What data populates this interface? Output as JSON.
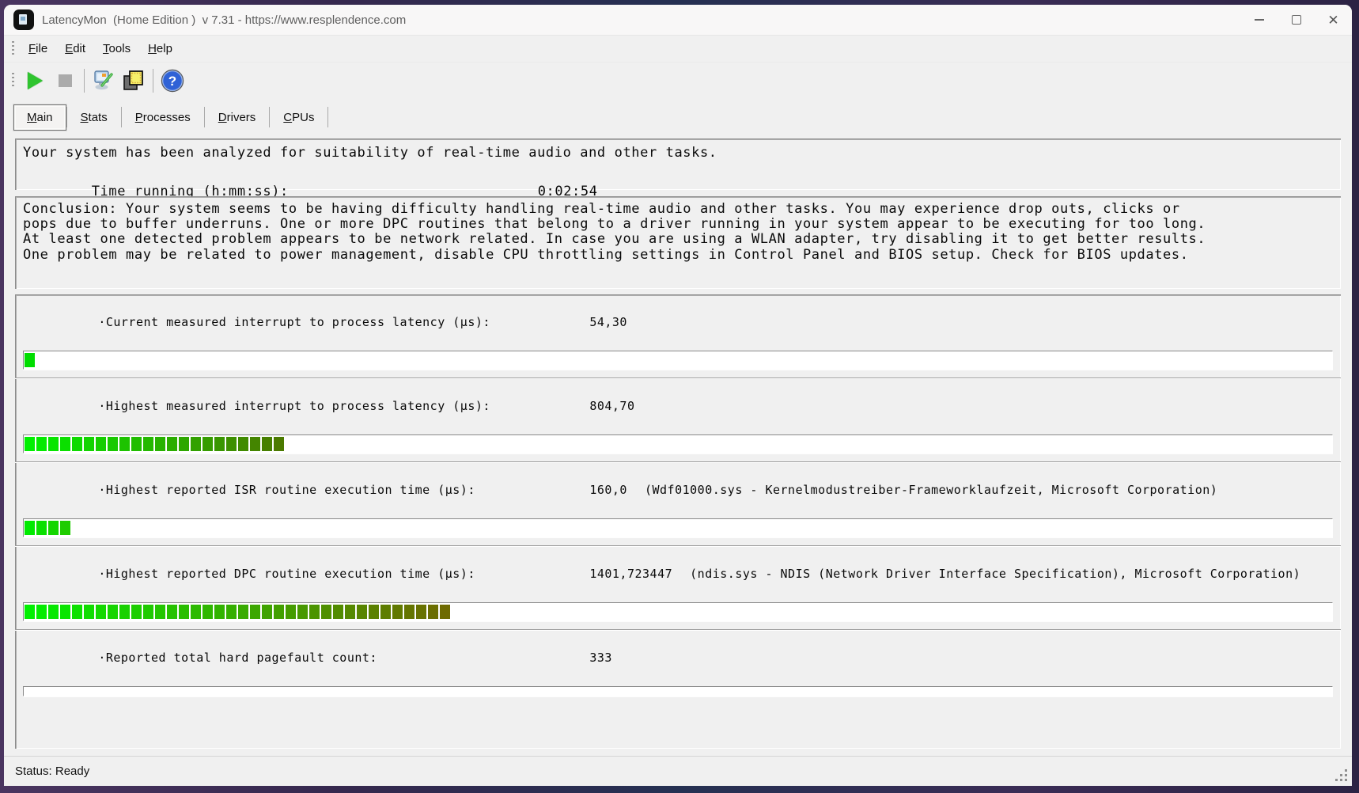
{
  "window": {
    "title": "LatencyMon  (Home Edition )  v 7.31 - https://www.resplendence.com"
  },
  "menu": {
    "items": [
      {
        "label": "File"
      },
      {
        "label": "Edit"
      },
      {
        "label": "Tools"
      },
      {
        "label": "Help"
      }
    ]
  },
  "toolbar": {
    "buttons": [
      {
        "name": "start-monitor",
        "icon": "play-icon"
      },
      {
        "name": "stop-monitor",
        "icon": "stop-icon"
      },
      {
        "name": "edit-options",
        "icon": "monitor-pencil-icon"
      },
      {
        "name": "view-processes",
        "icon": "stacked-windows-icon"
      },
      {
        "name": "help",
        "icon": "question-mark-icon"
      }
    ]
  },
  "tabs": [
    {
      "label": "Main",
      "active": true
    },
    {
      "label": "Stats",
      "active": false
    },
    {
      "label": "Processes",
      "active": false
    },
    {
      "label": "Drivers",
      "active": false
    },
    {
      "label": "CPUs",
      "active": false
    }
  ],
  "report": {
    "summary": "Your system has been analyzed for suitability of real-time audio and other tasks.",
    "time_label": "Time running (h:mm:ss):",
    "time_value": "0:02:54"
  },
  "conclusion": {
    "lines": [
      "Conclusion: Your system seems to be having difficulty handling real-time audio and other tasks. You may experience drop outs, clicks or",
      "pops due to buffer underruns. One or more DPC routines that belong to a driver running in your system appear to be executing for too long.",
      "At least one detected problem appears to be network related. In case you are using a WLAN adapter, try disabling it to get better results.",
      "One problem may be related to power management, disable CPU throttling settings in Control Panel and BIOS setup. Check for BIOS updates."
    ]
  },
  "measurements": [
    {
      "label": "·Current measured interrupt to process latency (µs):",
      "value": "54,30",
      "detail": "",
      "bar": {
        "segments": 1,
        "color_start": "#00dd00",
        "color_end": "#00dd00"
      }
    },
    {
      "label": "·Highest measured interrupt to process latency (µs):",
      "value": "804,70",
      "detail": "",
      "bar": {
        "segments": 22,
        "color_start": "#00f000",
        "color_end": "#4b7a00"
      }
    },
    {
      "label": "·Highest reported ISR routine execution time (µs):",
      "value": "160,0",
      "detail": "(Wdf01000.sys - Kernelmodustreiber-Frameworklaufzeit, Microsoft Corporation)",
      "bar": {
        "segments": 4,
        "color_start": "#00ea00",
        "color_end": "#1fcc00"
      }
    },
    {
      "label": "·Highest reported DPC routine execution time (µs):",
      "value": "1401,723447",
      "detail": "(ndis.sys - NDIS (Network Driver Interface Specification), Microsoft Corporation)",
      "bar": {
        "segments": 36,
        "color_start": "#00f000",
        "color_end": "#6e6a00"
      }
    },
    {
      "label": "·Reported total hard pagefault count:",
      "value": "333",
      "detail": "",
      "bar": {
        "segments": 0,
        "color_start": "#00dd00",
        "color_end": "#00dd00"
      }
    }
  ],
  "status_bar": {
    "text": "Status: Ready"
  },
  "colors": {
    "bar_bright_green": "#00f000",
    "bar_dark_green": "#4b7a00",
    "bar_olive": "#6e6a00",
    "play_green": "#2fc42f",
    "title_text": "#5f5f5f"
  }
}
